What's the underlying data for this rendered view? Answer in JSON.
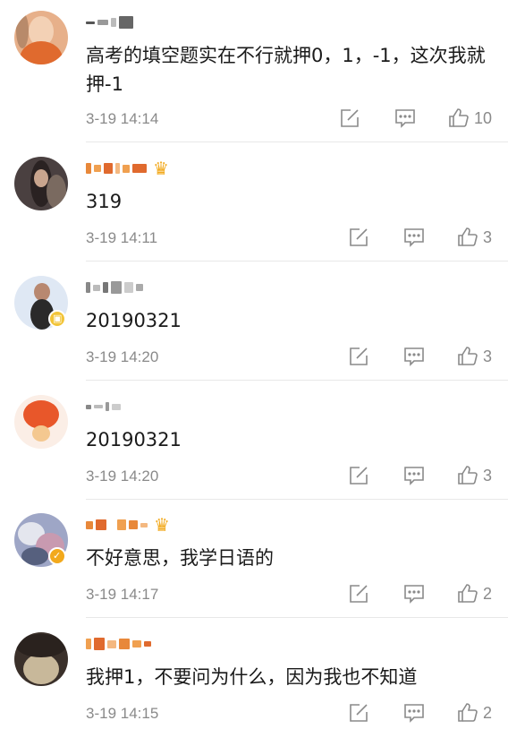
{
  "comments": [
    {
      "text": "高考的填空题实在不行就押0，1，-1，这次我就押-1",
      "time": "3-19 14:14",
      "likes": "10",
      "avatar_color": "#d9a27a",
      "has_crown": false,
      "badge": ""
    },
    {
      "text": "319",
      "time": "3-19 14:11",
      "likes": "3",
      "avatar_color": "#3c3c3c",
      "has_crown": true,
      "badge": ""
    },
    {
      "text": "20190321",
      "time": "3-19 14:20",
      "likes": "3",
      "avatar_color": "#c8d8ee",
      "has_crown": false,
      "badge": "vip"
    },
    {
      "text": "20190321",
      "time": "3-19 14:20",
      "likes": "3",
      "avatar_color": "#e8572a",
      "has_crown": false,
      "badge": ""
    },
    {
      "text": "不好意思，我学日语的",
      "time": "3-19 14:17",
      "likes": "2",
      "avatar_color": "#8a93b8",
      "has_crown": true,
      "badge": "verified"
    },
    {
      "text": "我押1，不要问为什么，因为我也不知道",
      "time": "3-19 14:15",
      "likes": "2",
      "avatar_color": "#5a4a3e",
      "has_crown": false,
      "badge": ""
    }
  ],
  "icons": {
    "share": "share-edit-icon",
    "reply": "comment-icon",
    "like": "thumbs-up-icon"
  },
  "colors": {
    "crown": "#f2a91c",
    "muted": "#8a8a8a"
  }
}
